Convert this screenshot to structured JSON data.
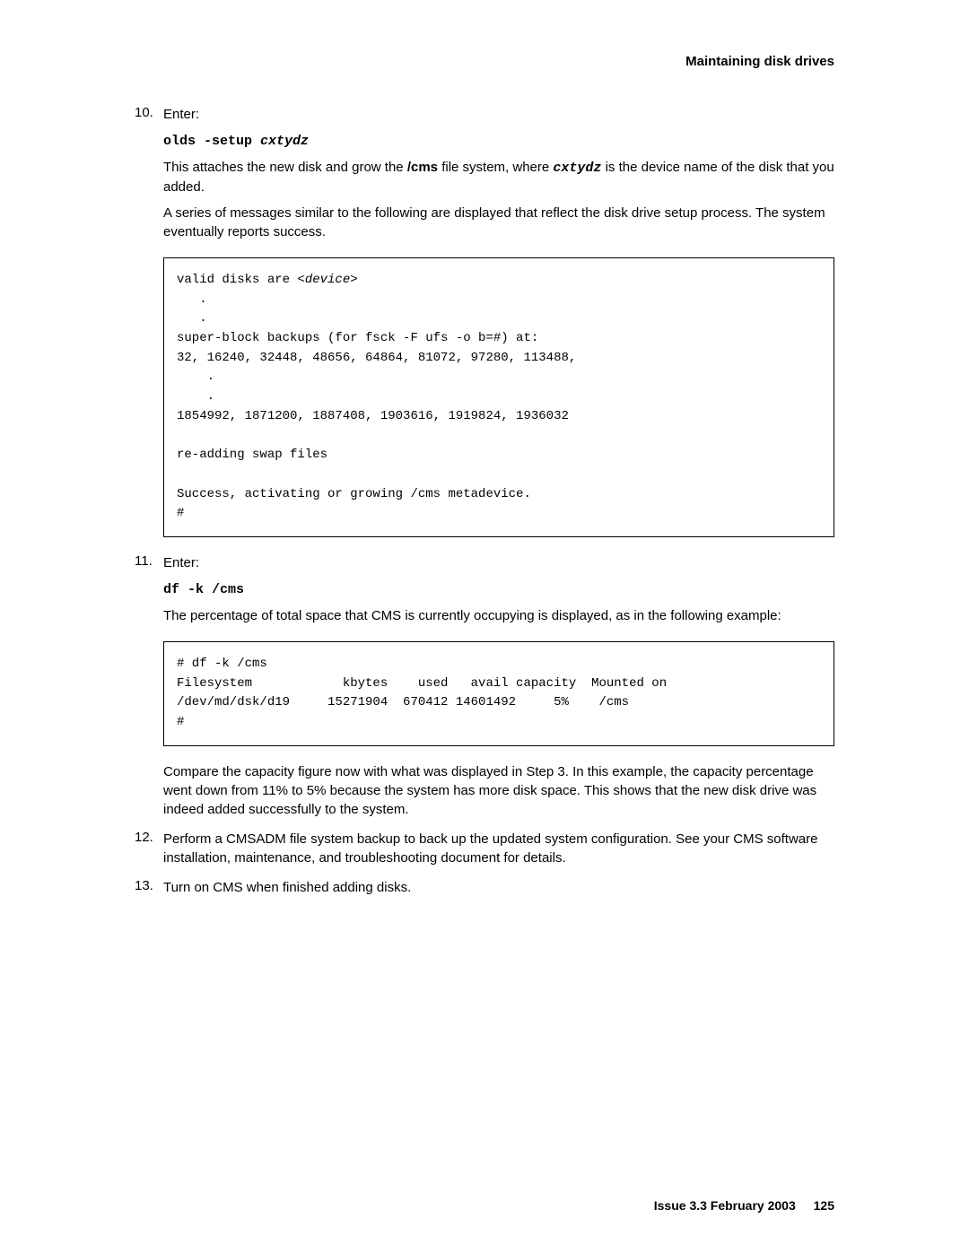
{
  "header": {
    "section_title": "Maintaining disk drives"
  },
  "steps": {
    "s10": {
      "num": "10.",
      "enter": "Enter:",
      "cmd_prefix": "olds -setup ",
      "cmd_arg": "cxtydz",
      "p1_a": "This attaches the new disk and grow the ",
      "p1_b": "/cms",
      "p1_c": " file system, where ",
      "p1_d": "cxtydz",
      "p1_e": " is the device name of the disk that you added.",
      "p2": "A series of messages similar to the following are displayed that reflect the disk drive setup process. The system eventually reports success.",
      "term_pre": "valid disks are ",
      "term_dev": "<device>",
      "term_rest": "\n   .\n   .\nsuper-block backups (for fsck -F ufs -o b=#) at:\n32, 16240, 32448, 48656, 64864, 81072, 97280, 113488,\n    .\n    .\n1854992, 1871200, 1887408, 1903616, 1919824, 1936032\n\nre-adding swap files\n\nSuccess, activating or growing /cms metadevice.\n#"
    },
    "s11": {
      "num": "11.",
      "enter": "Enter:",
      "cmd": "df -k /cms",
      "p1": "The percentage of total space that CMS is currently occupying is displayed, as in the following example:",
      "term": "# df -k /cms\nFilesystem            kbytes    used   avail capacity  Mounted on\n/dev/md/dsk/d19     15271904  670412 14601492     5%    /cms\n#",
      "p2": "Compare the capacity figure now with what was displayed in Step 3. In this example, the capacity percentage went down from 11% to 5% because the system has more disk space. This shows that the new disk drive was indeed added successfully to the system."
    },
    "s12": {
      "num": "12.",
      "text": "Perform a CMSADM file system backup to back up the updated system configuration. See your CMS software installation, maintenance, and troubleshooting document for details."
    },
    "s13": {
      "num": "13.",
      "text": "Turn on CMS when finished adding disks."
    }
  },
  "footer": {
    "issue": "Issue 3.3   February 2003",
    "page": "125"
  }
}
